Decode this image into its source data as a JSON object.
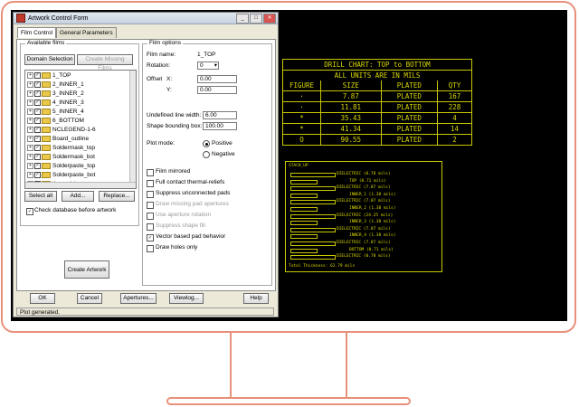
{
  "dialog": {
    "title": "Artwork Control Form",
    "tabs": [
      "Film Control",
      "General Parameters"
    ],
    "available_films_label": "Available films",
    "domain_selection_label": "Domain Selection",
    "create_missing_films_label": "Create Missing Films",
    "films": [
      "1_TOP",
      "2_INNER_1",
      "3_INNER_2",
      "4_INNER_3",
      "5_INNER_4",
      "6_BOTTOM",
      "NCLEGEND-1-6",
      "Board_outline",
      "Soldermask_top",
      "Soldermask_bot",
      "Solderpaste_top",
      "Solderpaste_bot",
      "Assembly_top"
    ],
    "select_all_label": "Select all",
    "add_label": "Add...",
    "replace_label": "Replace...",
    "check_db_label": "Check database before artwork",
    "create_artwork_label": "Create Artwork",
    "film_options_label": "Film options",
    "film_name_label": "Film name:",
    "film_name_value": "1_TOP",
    "rotation_label": "Rotation:",
    "rotation_value": "0",
    "offset_label": "Offset",
    "offset_x_label": "X:",
    "offset_x_value": "0.00",
    "offset_y_label": "Y:",
    "offset_y_value": "0.00",
    "undefined_line_width_label": "Undefined line width:",
    "undefined_line_width_value": "6.00",
    "shape_bounding_box_label": "Shape bounding box:",
    "shape_bounding_box_value": "100.00",
    "plot_mode_label": "Plot mode:",
    "positive_label": "Positive",
    "negative_label": "Negative",
    "options": [
      {
        "label": "Film mirrored",
        "checked": false,
        "enabled": true
      },
      {
        "label": "Full contact thermal-reliefs",
        "checked": false,
        "enabled": true
      },
      {
        "label": "Suppress unconnected pads",
        "checked": false,
        "enabled": true
      },
      {
        "label": "Draw missing pad apertures",
        "checked": false,
        "enabled": false
      },
      {
        "label": "Use aperture rotation",
        "checked": false,
        "enabled": false
      },
      {
        "label": "Suppress shape fill",
        "checked": false,
        "enabled": false
      },
      {
        "label": "Vector based pad behavior",
        "checked": true,
        "enabled": true
      },
      {
        "label": "Draw holes only",
        "checked": false,
        "enabled": true
      }
    ],
    "ok_label": "OK",
    "cancel_label": "Cancel",
    "apertures_label": "Apertures...",
    "viewlog_label": "Viewlog...",
    "help_label": "Help",
    "status": "Plot generated."
  },
  "drill_chart": {
    "title": "DRILL CHART: TOP to BOTTOM",
    "subtitle": "ALL UNITS ARE IN MILS",
    "headers": [
      "FIGURE",
      "SIZE",
      "PLATED",
      "QTY"
    ],
    "rows": [
      [
        "·",
        "7.87",
        "PLATED",
        "167"
      ],
      [
        "·",
        "11.81",
        "PLATED",
        "228"
      ],
      [
        "*",
        "35.43",
        "PLATED",
        "4"
      ],
      [
        "*",
        "41.34",
        "PLATED",
        "14"
      ],
      [
        "O",
        "90.55",
        "PLATED",
        "2"
      ]
    ]
  },
  "stackup": {
    "title": "STACK_UP",
    "labels": [
      "DIELECTRIC (0.78 mils)",
      "TOP (0.71 mils)",
      "DIELECTRIC (7.87 mils)",
      "INNER_1 (1.38 mils)",
      "DIELECTRIC (7.87 mils)",
      "INNER_2 (1.38 mils)",
      "DIELECTRIC (24.25 mils)",
      "INNER_3 (1.38 mils)",
      "DIELECTRIC (7.87 mils)",
      "INNER_4 (1.38 mils)",
      "DIELECTRIC (7.87 mils)",
      "BOTTOM (0.71 mils)",
      "DIELECTRIC (0.78 mils)"
    ],
    "total": "Total Thickness: 62.79 mils"
  }
}
